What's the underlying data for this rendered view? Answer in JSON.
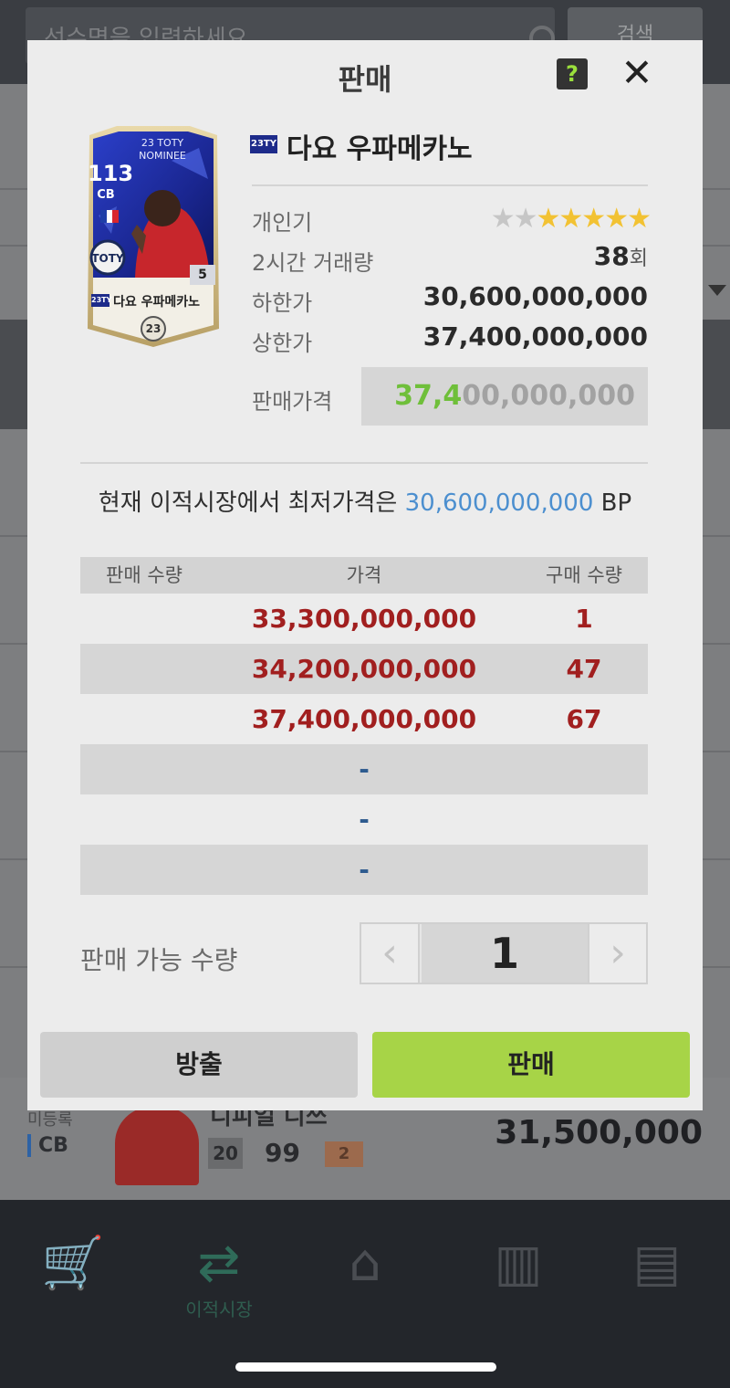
{
  "background": {
    "search_placeholder": "선수명을 입력하세요",
    "search_button": "검색",
    "player_row": {
      "status": "미등록",
      "position": "CB",
      "name": "디피얼 디쓰",
      "level": "20",
      "ovr": "99",
      "badge": "2",
      "price": "31,500,000"
    }
  },
  "nav": {
    "items": [
      {
        "icon": "cart-icon",
        "label": ""
      },
      {
        "icon": "transfer-icon",
        "label": "이적시장"
      },
      {
        "icon": "home-icon",
        "label": ""
      },
      {
        "icon": "squad-icon",
        "label": ""
      },
      {
        "icon": "locker-icon",
        "label": ""
      }
    ]
  },
  "modal": {
    "title": "판매",
    "help_label": "?",
    "close_label": "✕",
    "card": {
      "ovr": "113",
      "position": "CB",
      "series_line1": "23 TOTY",
      "series_line2": "NOMINEE",
      "enhance": "5",
      "season_tag": "23TY",
      "name": "다요 우파메카노",
      "season": "23"
    },
    "player_tag": "23TY",
    "player_name": "다요 우파메카노",
    "info": {
      "popularity_label": "개인기",
      "popularity_stars_off": 2,
      "popularity_stars_on": 5,
      "volume_label": "2시간 거래량",
      "volume_value": "38",
      "volume_unit": "회",
      "min_label": "하한가",
      "min_value": "30,600,000,000",
      "max_label": "상한가",
      "max_value": "37,400,000,000",
      "sale_label": "판매가격",
      "sale_price_highlight": "37,4",
      "sale_price_rest": "00,000,000"
    },
    "lowest_msg_prefix": "현재 이적시장에서 최저가격은 ",
    "lowest_msg_price": "30,600,000,000",
    "lowest_msg_suffix": " BP",
    "table": {
      "headers": [
        "판매 수량",
        "가격",
        "구매 수량"
      ],
      "rows": [
        {
          "sell": "",
          "price": "33,300,000,000",
          "buy": "1"
        },
        {
          "sell": "",
          "price": "34,200,000,000",
          "buy": "47"
        },
        {
          "sell": "",
          "price": "37,400,000,000",
          "buy": "67"
        },
        {
          "sell": "",
          "price": "-",
          "buy": ""
        },
        {
          "sell": "",
          "price": "-",
          "buy": ""
        },
        {
          "sell": "",
          "price": "-",
          "buy": ""
        }
      ]
    },
    "qty_label": "판매 가능 수량",
    "qty_value": "1",
    "prev_label": "‹",
    "next_label": "›",
    "release_button": "방출",
    "sell_button": "판매"
  }
}
